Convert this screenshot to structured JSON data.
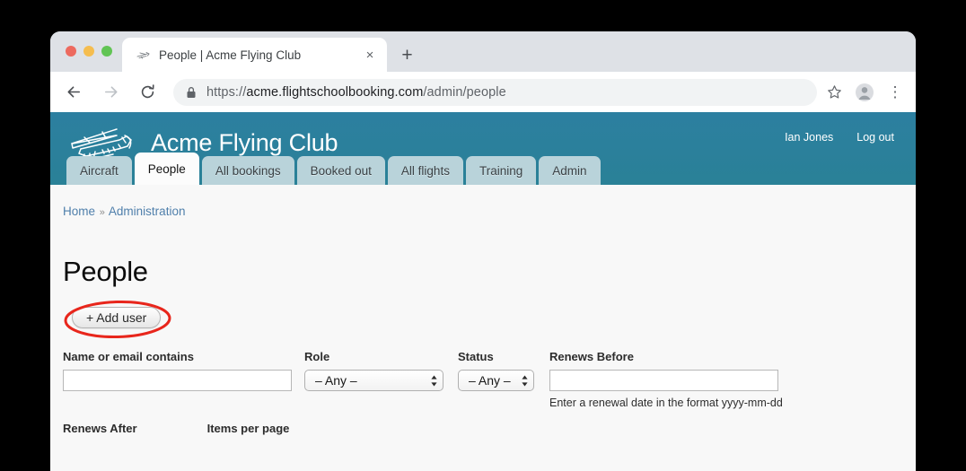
{
  "browser": {
    "tab": {
      "title": "People | Acme Flying Club",
      "favicon": "airplane-icon",
      "close_label": "×"
    },
    "new_tab_label": "+",
    "nav": {
      "back": "←",
      "forward": "→",
      "reload": "⟳"
    },
    "omnibox": {
      "lock": "lock-icon",
      "scheme": "https://",
      "host": "acme.flightschoolbooking.com",
      "path": "/admin/people"
    },
    "actions": {
      "bookmark": "star-icon",
      "profile": "avatar-icon",
      "menu": "⋮"
    },
    "traffic_lights": {
      "close": "#ed6a5f",
      "minimize": "#f5bd4f",
      "zoom": "#61c454"
    }
  },
  "site": {
    "brand_name": "Acme Flying Club",
    "logo": "airplane-logo",
    "user_name": "Ian Jones",
    "logout_label": "Log out",
    "header_color_top": "#2c7fa0",
    "header_color_bottom": "#2a8197",
    "tabs": [
      {
        "label": "Aircraft",
        "active": false
      },
      {
        "label": "People",
        "active": true
      },
      {
        "label": "All bookings",
        "active": false
      },
      {
        "label": "Booked out",
        "active": false
      },
      {
        "label": "All flights",
        "active": false
      },
      {
        "label": "Training",
        "active": false
      },
      {
        "label": "Admin",
        "active": false
      }
    ]
  },
  "page": {
    "breadcrumb": {
      "home": "Home",
      "separator": "»",
      "current": "Administration"
    },
    "title": "People",
    "add_user_label": "+ Add user",
    "annotation_color": "#e8261c",
    "filters": {
      "name": {
        "label": "Name or email contains",
        "value": "",
        "placeholder": ""
      },
      "role": {
        "label": "Role",
        "value": "– Any –"
      },
      "status": {
        "label": "Status",
        "value": "– Any –"
      },
      "renews_before": {
        "label": "Renews Before",
        "value": "",
        "placeholder": "",
        "help": "Enter a renewal date in the format yyyy-mm-dd"
      },
      "renews_after": {
        "label": "Renews After"
      },
      "items_per_page": {
        "label": "Items per page"
      }
    }
  }
}
